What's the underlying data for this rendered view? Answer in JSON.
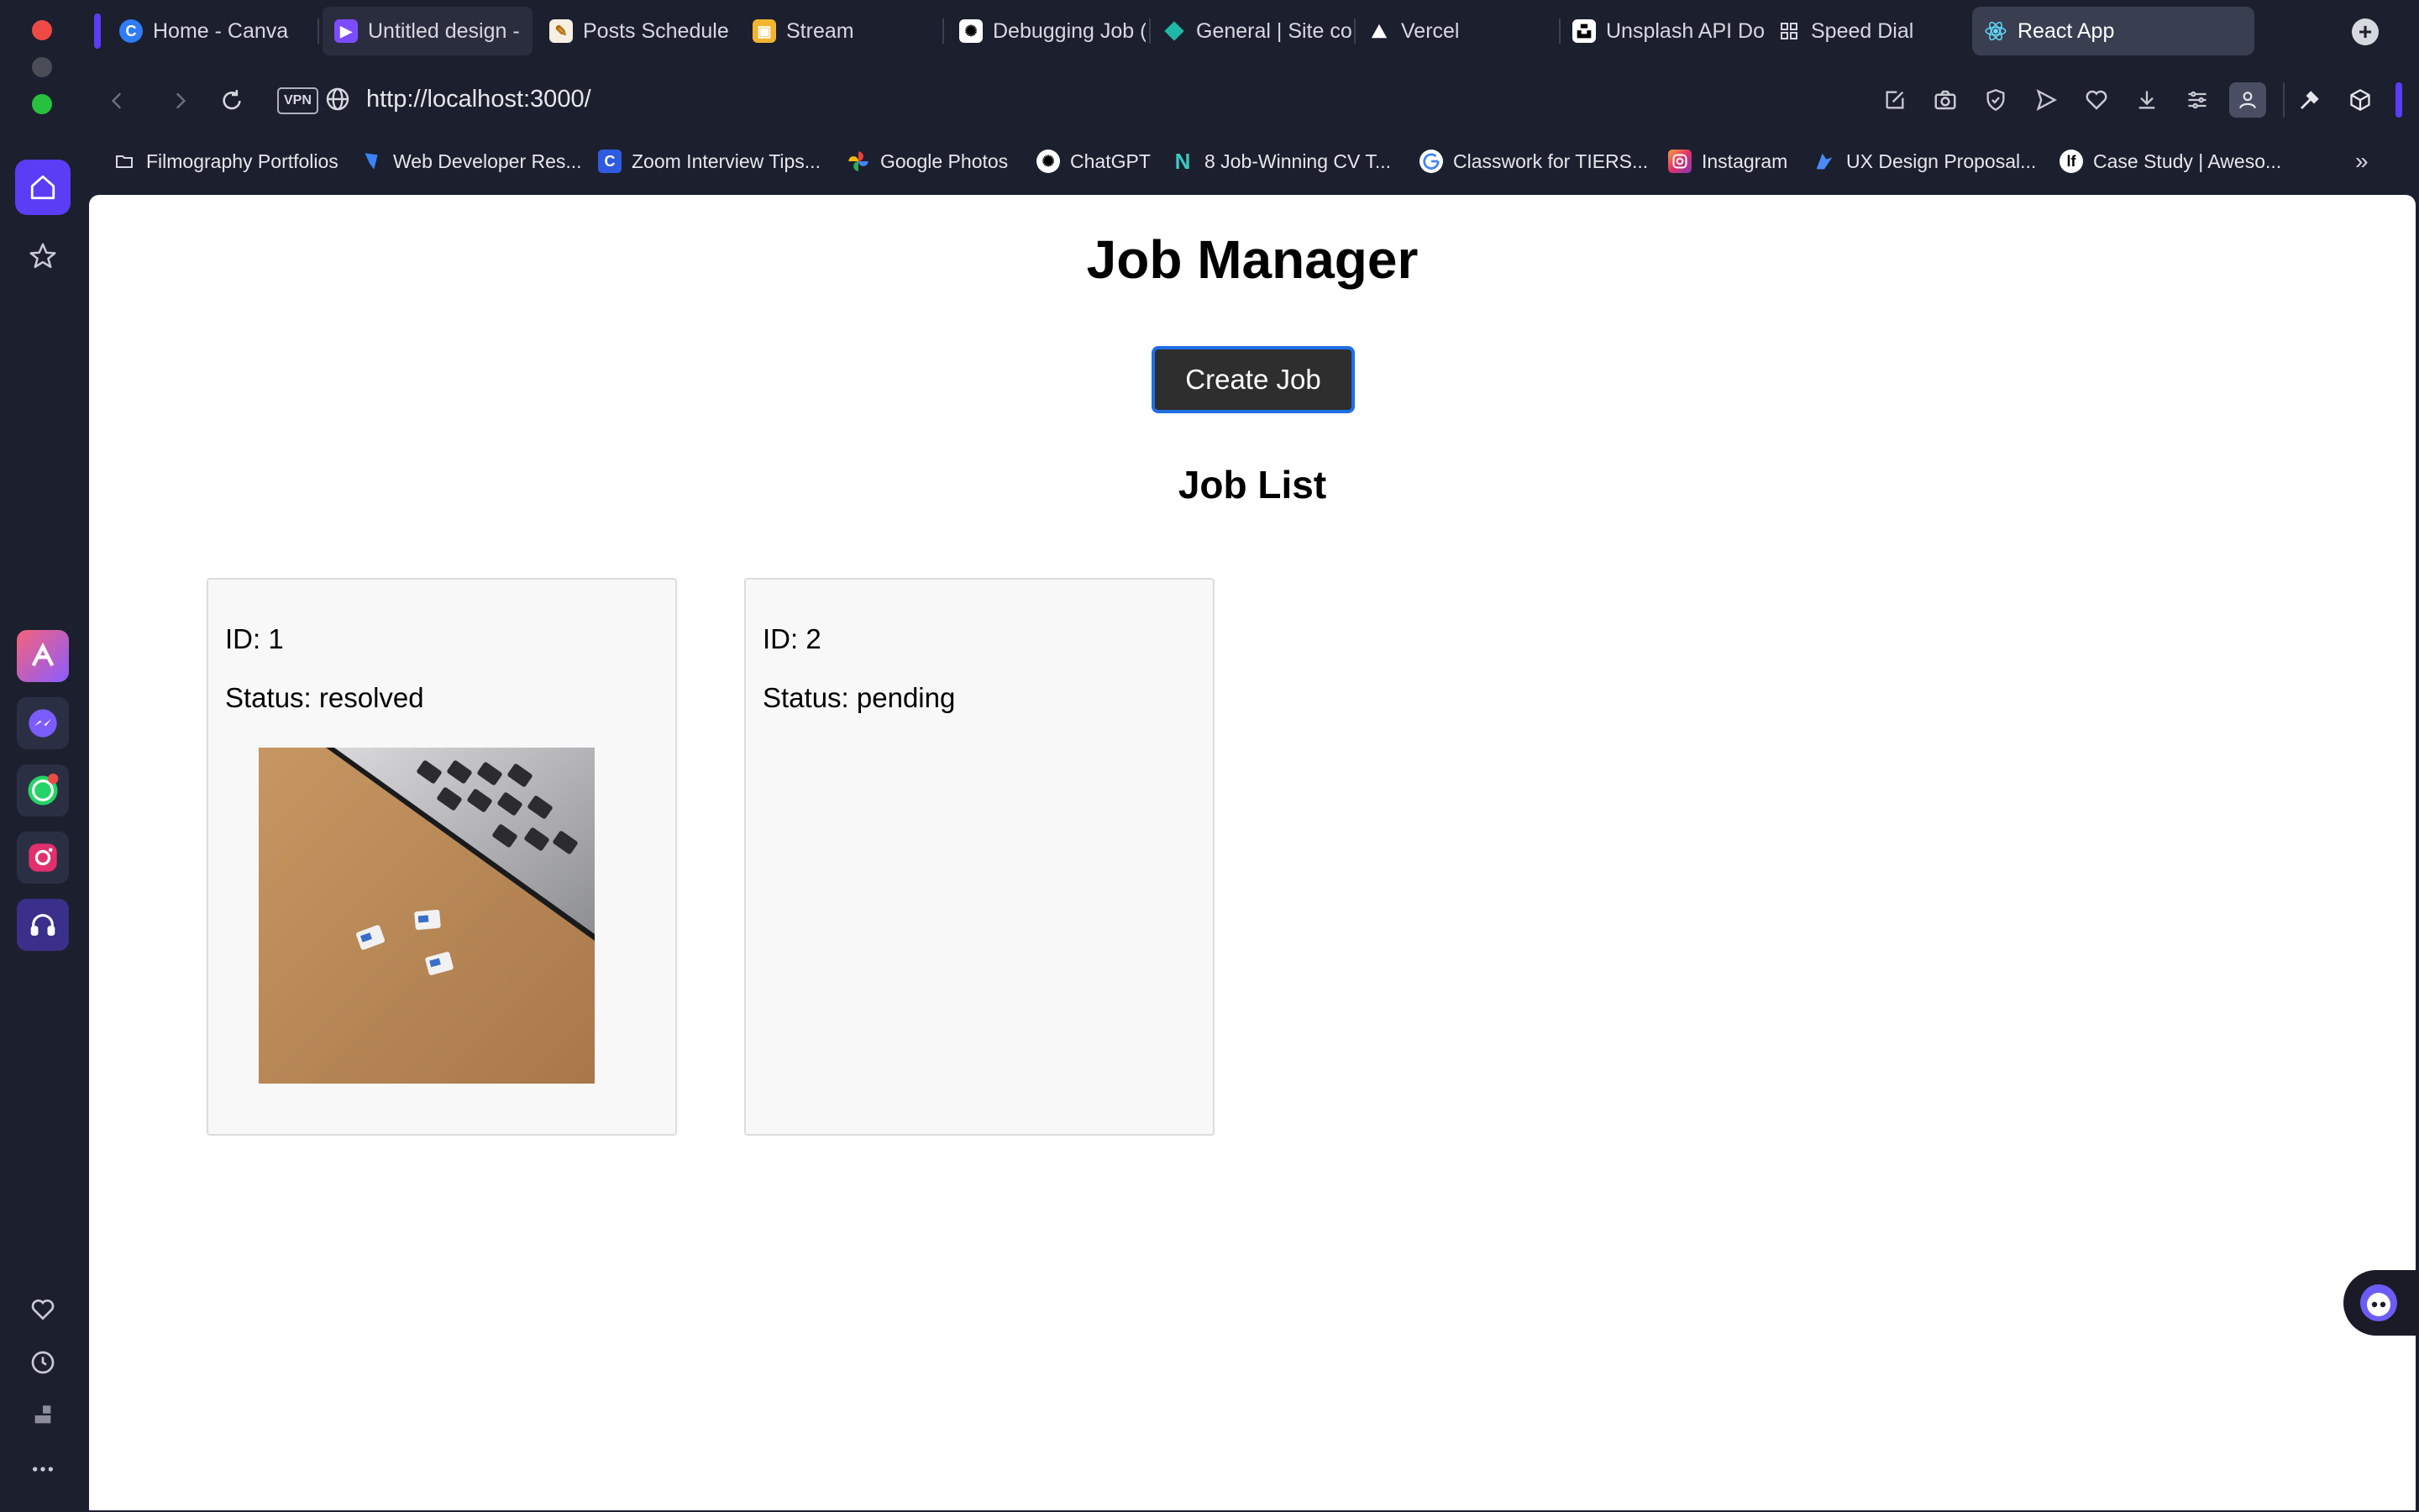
{
  "window": {
    "traffic_lights": [
      "close",
      "minimize",
      "zoom"
    ]
  },
  "sidebar": {
    "top": [
      {
        "name": "home-icon",
        "active": true
      },
      {
        "name": "star-icon",
        "active": false
      }
    ],
    "apps": [
      {
        "name": "aria-icon",
        "color": "#e8506e"
      },
      {
        "name": "messenger-icon",
        "color": "#7b5cff"
      },
      {
        "name": "whatsapp-icon",
        "color": "#25d366",
        "badge": true
      },
      {
        "name": "instagram-icon",
        "color": "#e1306c"
      },
      {
        "name": "music-player-icon",
        "color": "#5b3df5"
      }
    ],
    "bottom": [
      "heart-icon",
      "history-icon",
      "extensions-icon",
      "more-icon"
    ]
  },
  "tabs": [
    {
      "title": "Home - Canva",
      "icon": "canva-icon",
      "color": "#2f7cf6"
    },
    {
      "title": "Untitled design -",
      "icon": "video-icon",
      "color": "#7b4dff"
    },
    {
      "title": "Posts Schedule",
      "icon": "notes-icon",
      "color": "#f5c242"
    },
    {
      "title": "Stream",
      "icon": "stream-icon",
      "color": "#f2b530"
    },
    {
      "title": "Debugging Job (",
      "icon": "chatgpt-icon",
      "color": "#ffffff"
    },
    {
      "title": "General | Site co",
      "icon": "diamond-icon",
      "color": "#1fb8a6"
    },
    {
      "title": "Vercel",
      "icon": "vercel-icon",
      "color": "#ffffff"
    },
    {
      "title": "Unsplash API Do",
      "icon": "unsplash-icon",
      "color": "#ffffff"
    },
    {
      "title": "Speed Dial",
      "icon": "speed-dial-icon",
      "color": "#d6d8e0"
    },
    {
      "title": "React App",
      "icon": "react-icon",
      "color": "#61dafb",
      "active": true
    }
  ],
  "address_bar": {
    "vpn_label": "VPN",
    "url": "http://localhost:3000/"
  },
  "bookmarks": [
    {
      "label": "Filmography Portfolios",
      "icon": "folder-icon",
      "color": "#d6d8e0"
    },
    {
      "label": "Web Developer Res...",
      "icon": "bookmark-blue-icon",
      "color": "#3b82f6"
    },
    {
      "label": "Zoom Interview Tips...",
      "icon": "c-icon",
      "color": "#2f5be0"
    },
    {
      "label": "Google Photos",
      "icon": "google-photos-icon",
      "color": "#fbbc05"
    },
    {
      "label": "ChatGPT",
      "icon": "chatgpt-icon",
      "color": "#ffffff"
    },
    {
      "label": "8 Job-Winning CV T...",
      "icon": "n-icon",
      "color": "#3bc9c2"
    },
    {
      "label": "Classwork for TIERS...",
      "icon": "google-icon",
      "color": "#ffffff"
    },
    {
      "label": "Instagram",
      "icon": "instagram-icon",
      "color": "#e1306c"
    },
    {
      "label": "UX Design Proposal...",
      "icon": "design-icon",
      "color": "#4b8bf5"
    },
    {
      "label": "Case Study | Aweso...",
      "icon": "case-study-icon",
      "color": "#ffffff"
    }
  ],
  "page": {
    "title": "Job Manager",
    "create_button": "Create Job",
    "list_title": "Job List",
    "jobs": [
      {
        "id": "ID: 1",
        "status": "Status: resolved",
        "has_image": true
      },
      {
        "id": "ID: 2",
        "status": "Status: pending",
        "has_image": false
      }
    ]
  },
  "colors": {
    "chrome_bg": "#1c1f2e",
    "accent": "#5b3df5",
    "button_bg": "#2e2e2e",
    "button_border": "#1f6fe5",
    "card_bg": "#f8f8f8"
  }
}
